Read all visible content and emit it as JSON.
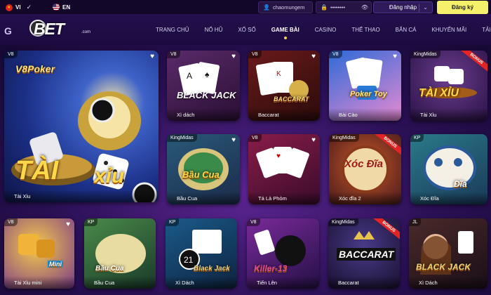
{
  "topbar": {
    "lang_vi": "VI",
    "lang_en": "EN",
    "username": "chaomungem",
    "password_mask": "••••••••",
    "login_label": "Đăng nhập",
    "register_label": "Đăng ký"
  },
  "logo": {
    "text": "BET",
    "suffix": ".com",
    "prefix": "G"
  },
  "nav": [
    "TRANG CHỦ",
    "NỔ HŨ",
    "XỔ SỐ",
    "GAME BÀI",
    "CASINO",
    "THỂ THAO",
    "BẮN CÁ",
    "KHUYẾN MÃI",
    "TẢI APP"
  ],
  "nav_active": "GAME BÀI",
  "games": {
    "featured": {
      "provider": "V8",
      "label": "Tài Xỉu",
      "logo": "V8Poker",
      "title1": "TÀI",
      "title2": "xỉu"
    },
    "row1": [
      {
        "provider": "V8",
        "label": "Xì dách",
        "art": "BLACK JACK"
      },
      {
        "provider": "V8",
        "label": "Baccarat",
        "art": "BACCARAT"
      },
      {
        "provider": "V8",
        "label": "Bài Cào",
        "art": "Poker Toy"
      },
      {
        "provider": "KingMidas",
        "label": "Tài Xỉu",
        "art": "TÀI XỈU",
        "bonus": "BONUS"
      }
    ],
    "row2": [
      {
        "provider": "KingMidas",
        "label": "Bầu Cua",
        "art": "Bầu Cua"
      },
      {
        "provider": "V8",
        "label": "Tá Lả Phỏm",
        "art": ""
      },
      {
        "provider": "KingMidas",
        "label": "Xóc đĩa 2",
        "art": "Xóc Đĩa",
        "bonus": "BONUS"
      },
      {
        "provider": "KP",
        "label": "Xóc Đĩa",
        "art": "Đĩa"
      }
    ],
    "row3": [
      {
        "provider": "V8",
        "label": "Tài Xỉu mini",
        "art": "Mini"
      },
      {
        "provider": "KP",
        "label": "Bầu Cua",
        "art": "Bầu Cua"
      },
      {
        "provider": "KP",
        "label": "Xì Dách",
        "art": "Black Jack"
      },
      {
        "provider": "V8",
        "label": "Tiến Lên",
        "art": "Killer-13"
      },
      {
        "provider": "KingMidas",
        "label": "Baccarat",
        "art": "BACCARAT",
        "bonus": "BONUS"
      },
      {
        "provider": "JL",
        "label": "Xì Dách",
        "art": "BLACK JACK"
      }
    ]
  },
  "colors": {
    "accent": "#f5f06a",
    "background": "#1b0c3d",
    "bonus": "#e42424"
  }
}
